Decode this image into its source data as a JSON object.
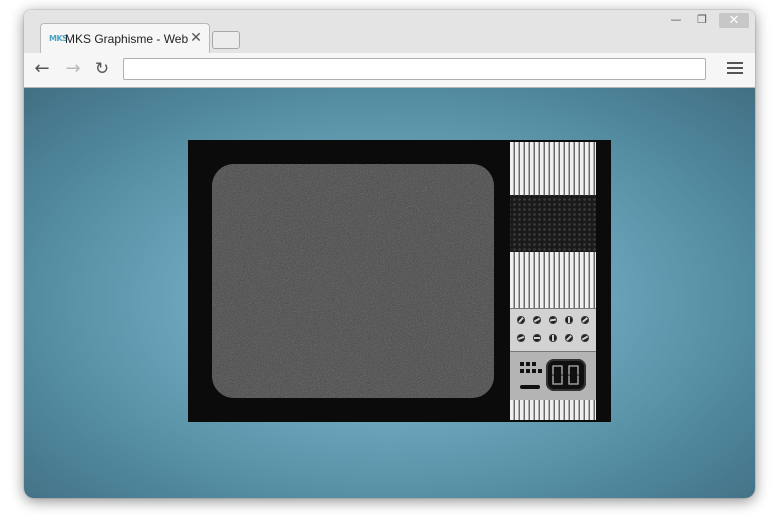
{
  "browser": {
    "tab": {
      "favicon_text": "MKS",
      "title": "MKS Graphisme - Web Pla",
      "close_glyph": "✕"
    },
    "window_controls": {
      "minimize_glyph": "—",
      "restore_glyph": "❐",
      "close_glyph": "✕"
    },
    "toolbar": {
      "back_glyph": "←",
      "forward_glyph": "→",
      "reload_glyph": "↻",
      "address_value": "",
      "menu_icon": "hamburger-menu-icon"
    }
  },
  "page": {
    "background": {
      "center_color": "#8fc3d4",
      "edge_color": "#426f82"
    },
    "tv": {
      "body_color": "#0b0b0b",
      "screen_noise": true,
      "display_digits": "00"
    }
  }
}
